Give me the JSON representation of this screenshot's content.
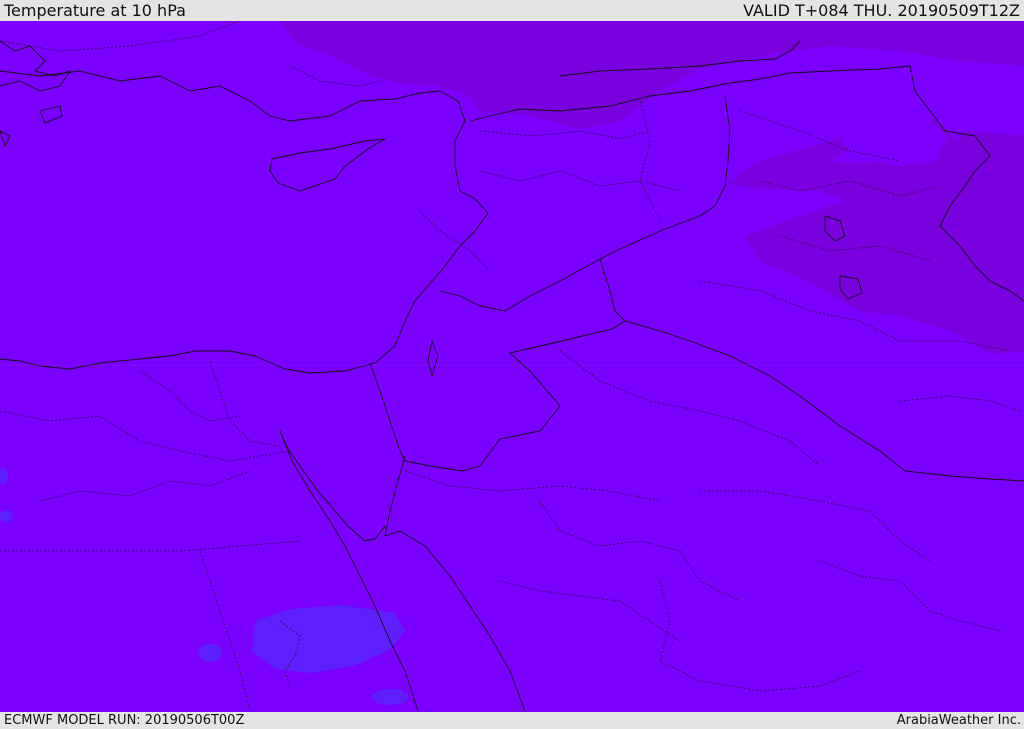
{
  "header": {
    "title": "Temperature at 10 hPa",
    "valid": "VALID T+084 THU. 20190509T12Z"
  },
  "footer": {
    "run": "ECMWF MODEL RUN: 20190506T00Z",
    "credit": "ArabiaWeather Inc."
  },
  "map": {
    "field_colors": {
      "base": "#7b00ff",
      "warm_band": "#7a00e0",
      "cool_patch": "#5e1fff"
    }
  }
}
